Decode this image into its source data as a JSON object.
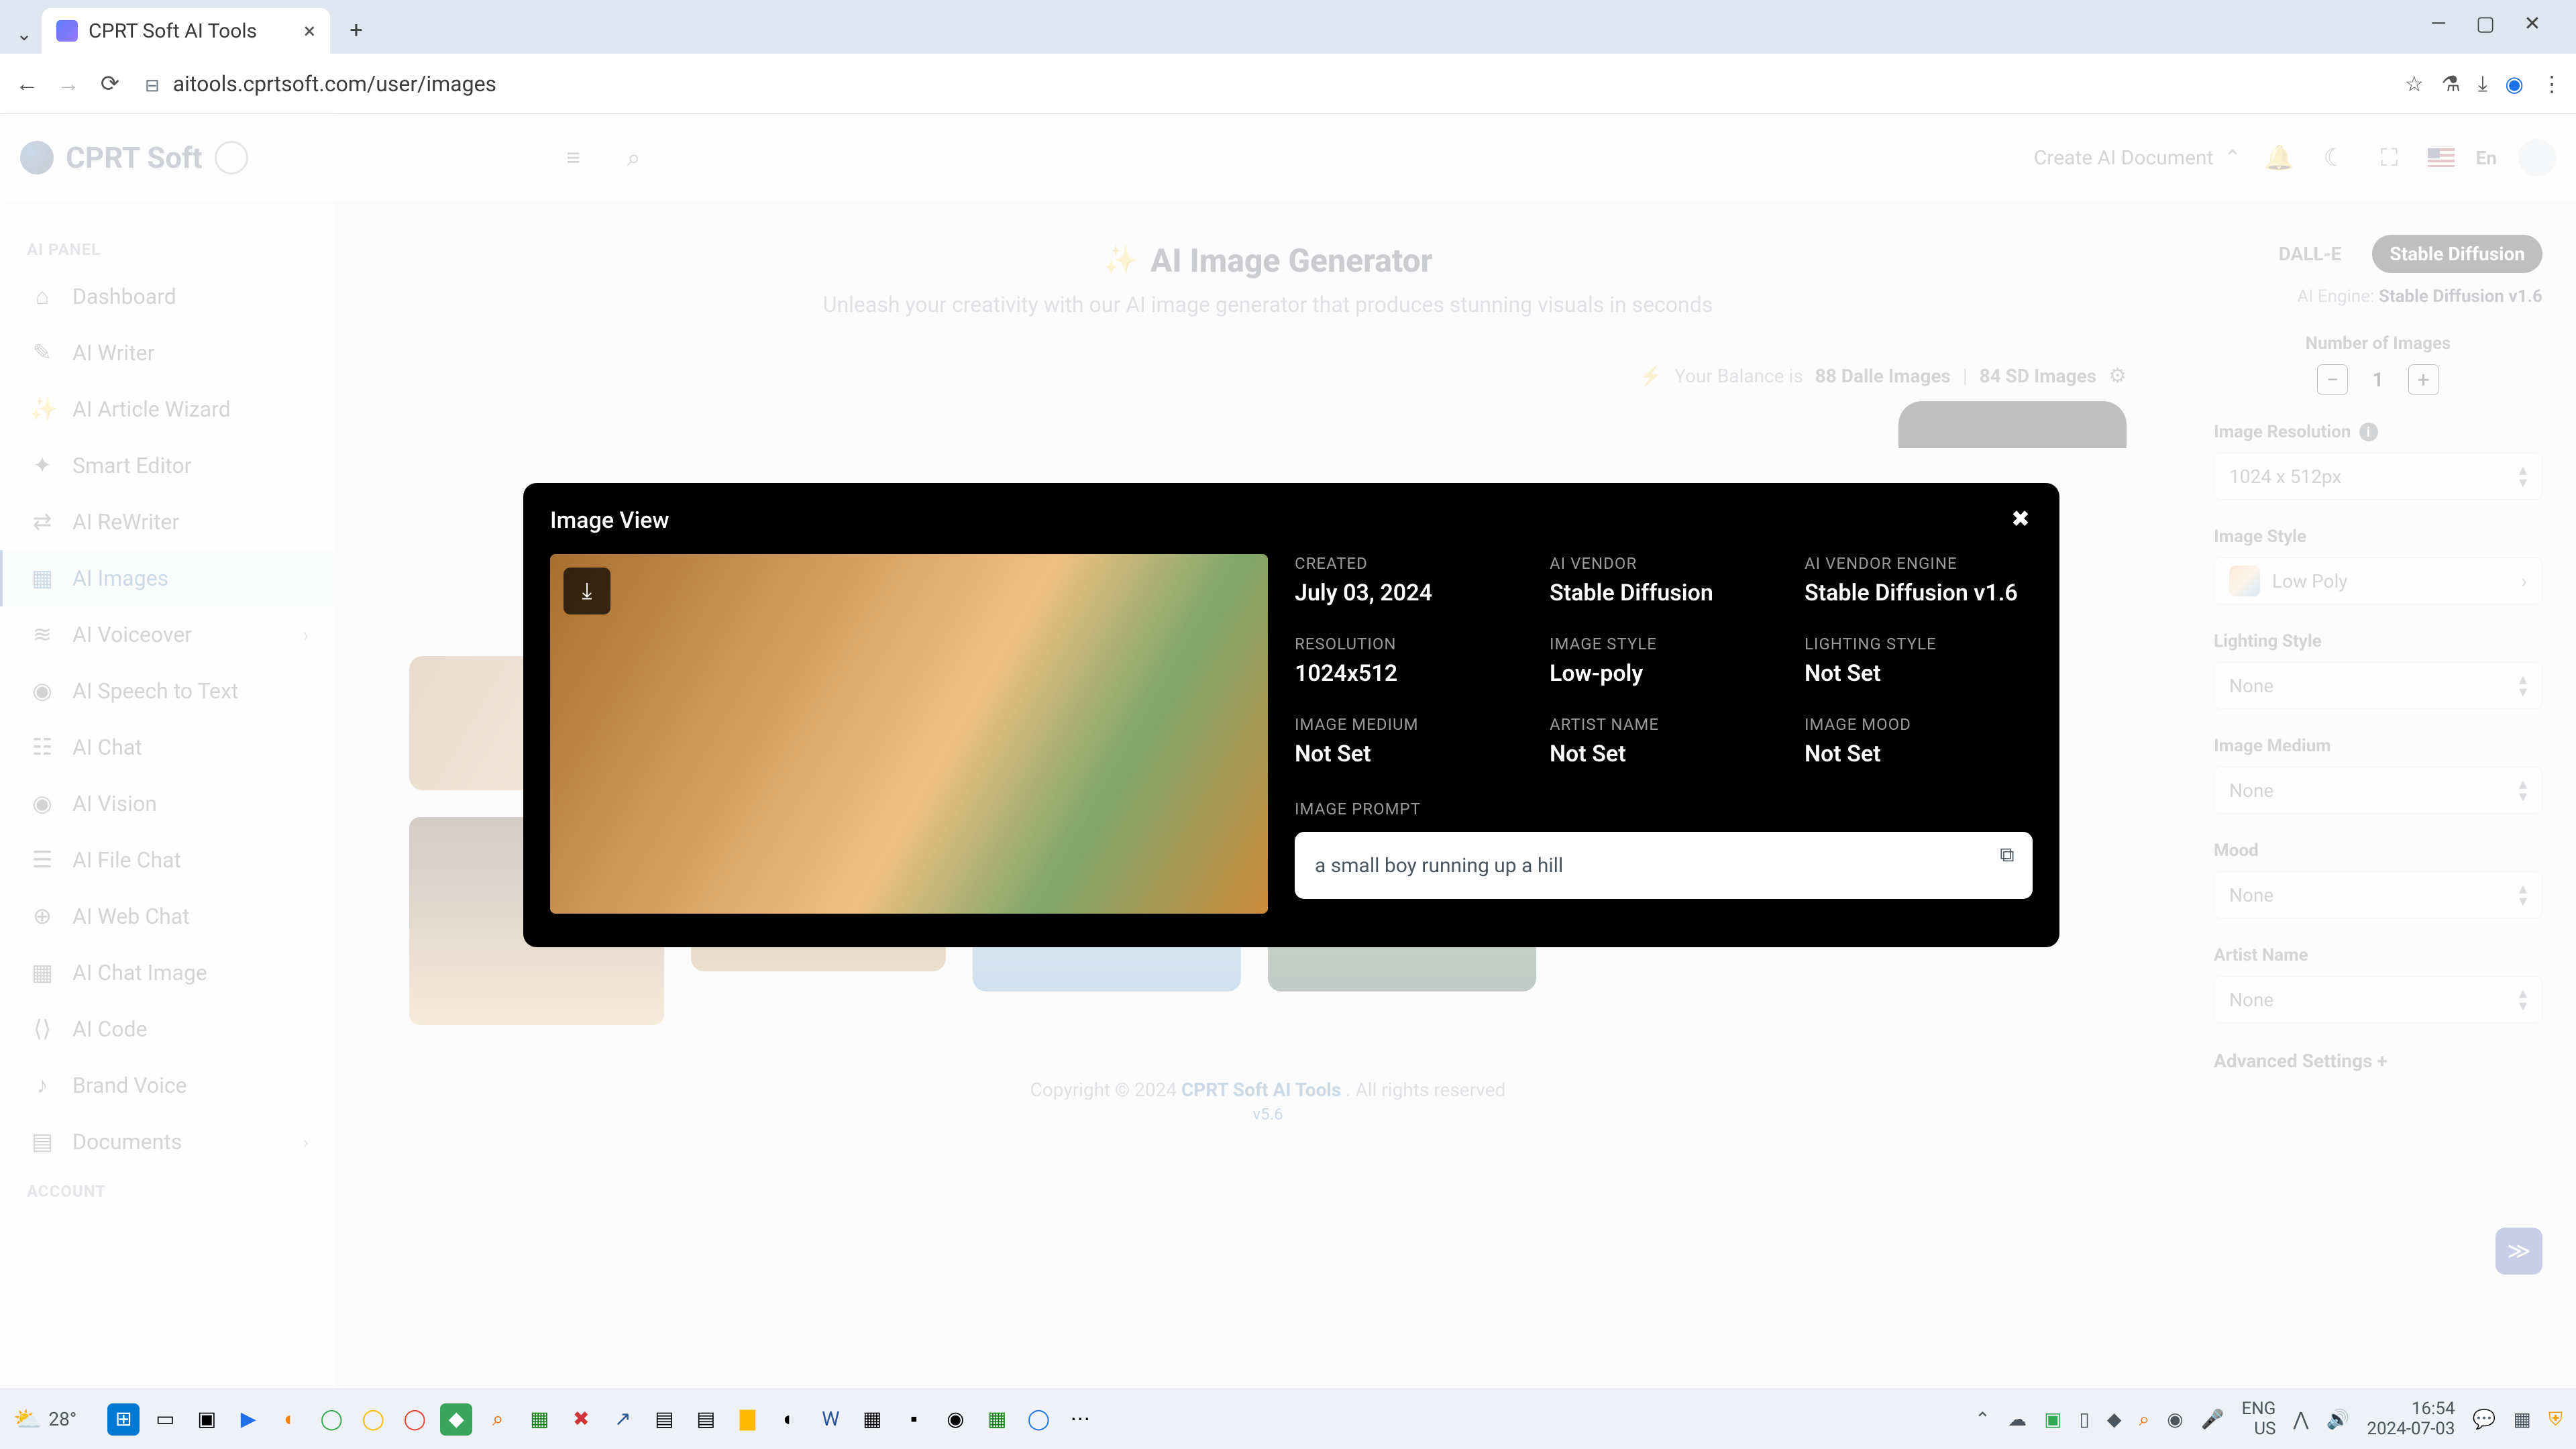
{
  "browser": {
    "tab_title": "CPRT Soft AI Tools",
    "url": "aitools.cprtsoft.com/user/images"
  },
  "header": {
    "brand": "CPRT Soft",
    "create_doc": "Create AI Document",
    "lang": "En"
  },
  "sidebar": {
    "section1": "AI PANEL",
    "items": [
      {
        "label": "Dashboard",
        "icon": "⌂"
      },
      {
        "label": "AI Writer",
        "icon": "✎"
      },
      {
        "label": "AI Article Wizard",
        "icon": "✨"
      },
      {
        "label": "Smart Editor",
        "icon": "✦"
      },
      {
        "label": "AI ReWriter",
        "icon": "⇄"
      },
      {
        "label": "AI Images",
        "icon": "▦",
        "active": true
      },
      {
        "label": "AI Voiceover",
        "icon": "≋",
        "chev": true
      },
      {
        "label": "AI Speech to Text",
        "icon": "◉"
      },
      {
        "label": "AI Chat",
        "icon": "☷"
      },
      {
        "label": "AI Vision",
        "icon": "◉"
      },
      {
        "label": "AI File Chat",
        "icon": "☰"
      },
      {
        "label": "AI Web Chat",
        "icon": "⊕"
      },
      {
        "label": "AI Chat Image",
        "icon": "▦"
      },
      {
        "label": "AI Code",
        "icon": "⟨⟩"
      },
      {
        "label": "Brand Voice",
        "icon": "♪"
      },
      {
        "label": "Documents",
        "icon": "▤",
        "chev": true
      }
    ],
    "section2": "ACCOUNT"
  },
  "main": {
    "title": "AI Image Generator",
    "subtitle": "Unleash your creativity with our AI image generator that produces stunning visuals in seconds",
    "balance_prefix": "Your Balance is ",
    "balance_dalle": "88 Dalle Images",
    "balance_sep": " | ",
    "balance_sd": "84 SD Images",
    "footer_left": "Copyright © 2024 ",
    "footer_brand": "CPRT Soft AI Tools",
    "footer_right": ". All rights reserved",
    "version": "v5.6"
  },
  "right": {
    "tab_dalle": "DALL-E",
    "tab_sd": "Stable Diffusion",
    "engine_label": "AI Engine: ",
    "engine_value": "Stable Diffusion v1.6",
    "num_images_label": "Number of Images",
    "num_images_value": "1",
    "resolution_label": "Image Resolution",
    "resolution_value": "1024 x 512px",
    "style_label": "Image Style",
    "style_value": "Low Poly",
    "lighting_label": "Lighting Style",
    "lighting_value": "None",
    "medium_label": "Image Medium",
    "medium_value": "None",
    "mood_label": "Mood",
    "mood_value": "None",
    "artist_label": "Artist Name",
    "artist_value": "None",
    "advanced": "Advanced Settings +"
  },
  "modal": {
    "title": "Image View",
    "meta": {
      "created_label": "CREATED",
      "created_value": "July 03, 2024",
      "vendor_label": "AI VENDOR",
      "vendor_value": "Stable Diffusion",
      "engine_label": "AI VENDOR ENGINE",
      "engine_value": "Stable Diffusion v1.6",
      "resolution_label": "RESOLUTION",
      "resolution_value": "1024x512",
      "style_label": "IMAGE STYLE",
      "style_value": "Low-poly",
      "lighting_label": "LIGHTING STYLE",
      "lighting_value": "Not Set",
      "medium_label": "IMAGE MEDIUM",
      "medium_value": "Not Set",
      "artist_label": "ARTIST NAME",
      "artist_value": "Not Set",
      "mood_label": "IMAGE MOOD",
      "mood_value": "Not Set",
      "prompt_label": "IMAGE PROMPT",
      "prompt_value": "a small boy running up a hill"
    }
  },
  "taskbar": {
    "weather": "28°",
    "lang1": "ENG",
    "lang2": "US",
    "time": "16:54",
    "date": "2024-07-03"
  }
}
